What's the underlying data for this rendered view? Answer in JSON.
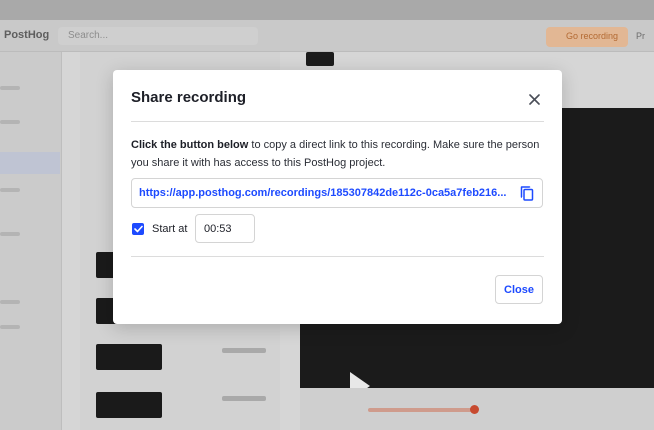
{
  "background": {
    "brand": "PostHog",
    "search_placeholder": "Search...",
    "record_button": "Go recording",
    "account": "Pr"
  },
  "modal": {
    "title": "Share recording",
    "description_bold": "Click the button below",
    "description_rest": " to copy a direct link to this recording. Make sure the person you share it with has access to this PostHog project.",
    "link": "https://app.posthog.com/recordings/185307842de112c-0ca5a7feb216...",
    "start_at_label": "Start at",
    "start_at_checked": true,
    "start_at_time": "00:53",
    "close_button": "Close"
  },
  "colors": {
    "accent": "#1d4aff",
    "text": "#1d1f27",
    "border": "#d4d4d4"
  },
  "icons": {
    "close": "close-icon",
    "copy": "copy-icon",
    "check": "check-icon"
  }
}
